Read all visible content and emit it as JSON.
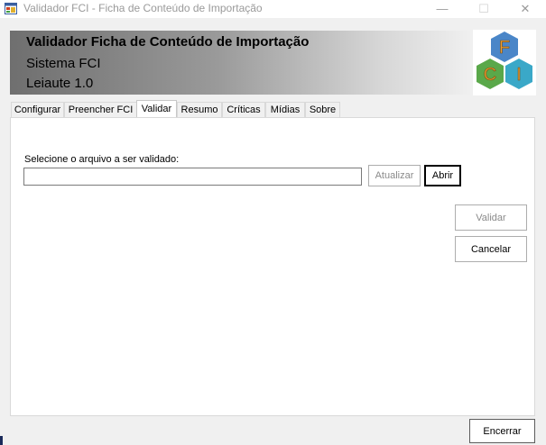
{
  "window": {
    "title": "Validador FCI - Ficha de Conteúdo de Importação",
    "minimize_glyph": "—",
    "maximize_glyph": "☐",
    "close_glyph": "✕"
  },
  "header": {
    "title": "Validador Ficha de Conteúdo de Importação",
    "subtitle": "Sistema FCI",
    "version": "Leiaute 1.0",
    "logo_letters": [
      "F",
      "C",
      "I"
    ]
  },
  "tabs": [
    {
      "label": "Configurar"
    },
    {
      "label": "Preencher FCI"
    },
    {
      "label": "Validar",
      "active": true
    },
    {
      "label": "Resumo"
    },
    {
      "label": "Críticas"
    },
    {
      "label": "Mídias"
    },
    {
      "label": "Sobre"
    }
  ],
  "validar": {
    "file_label": "Selecione o arquivo a ser validado:",
    "file_value": "",
    "atualizar_label": "Atualizar",
    "abrir_label": "Abrir",
    "validar_label": "Validar",
    "cancelar_label": "Cancelar"
  },
  "footer": {
    "encerrar_label": "Encerrar"
  },
  "colors": {
    "logo_blue": "#4a86c8",
    "logo_green": "#5aa84a",
    "logo_orange": "#e08a2a",
    "logo_cyan": "#3aa8c8",
    "logo_letter_orange": "#f0a030"
  }
}
